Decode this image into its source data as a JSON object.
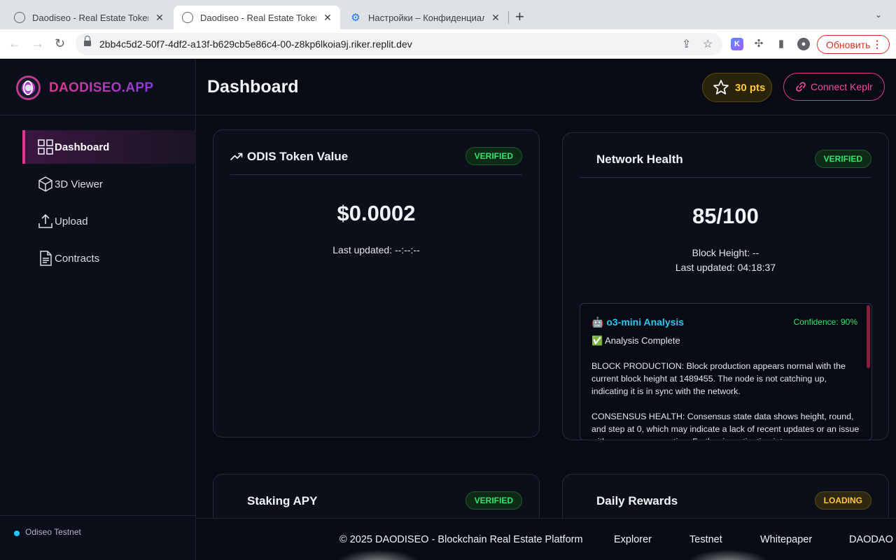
{
  "browser": {
    "tabs": [
      {
        "title": "Daodiseo - Real Estate Tokeniz",
        "active": false
      },
      {
        "title": "Daodiseo - Real Estate Tokeniz",
        "active": true
      },
      {
        "title": "Настройки – Конфиденциальн",
        "active": false
      }
    ],
    "new_tab": "+",
    "url": "2bb4c5d2-50f7-4df2-a13f-b629cb5e86c4-00-z8kp6lkoia9j.riker.replit.dev",
    "update_label": "Обновить"
  },
  "app": {
    "brand": "DAODISEO.APP",
    "page_title": "Dashboard",
    "points": "30 pts",
    "connect_label": "Connect Keplr",
    "network": "Odiseo Testnet",
    "colors": {
      "accent": "#e0388d",
      "verified": "#2ee66b",
      "loading": "#ffc83d",
      "analysis_title": "#29c6f2"
    }
  },
  "sidebar": {
    "items": [
      {
        "label": "Dashboard",
        "icon": "grid-icon",
        "active": true
      },
      {
        "label": "3D Viewer",
        "icon": "cube-icon",
        "active": false
      },
      {
        "label": "Upload",
        "icon": "upload-icon",
        "active": false
      },
      {
        "label": "Contracts",
        "icon": "document-icon",
        "active": false
      }
    ]
  },
  "cards": {
    "token": {
      "title": "ODIS Token Value",
      "badge": "VERIFIED",
      "value": "$0.0002",
      "updated": "Last updated: --:--:--"
    },
    "health": {
      "title": "Network Health",
      "badge": "VERIFIED",
      "value": "85/100",
      "block_height": "Block Height: --",
      "updated": "Last updated: 04:18:37",
      "analysis": {
        "title": "o3-mini Analysis",
        "confidence": "Confidence: 90%",
        "status": "✅ Analysis Complete",
        "paragraphs": [
          "BLOCK PRODUCTION: Block production appears normal with the current block height at 1489455. The node is not catching up, indicating it is in sync with the network.",
          "CONSENSUS HEALTH: Consensus state data shows height, round, and step at 0, which may indicate a lack of recent updates or an issue with consensus reporting. Further investigation into"
        ]
      }
    },
    "staking": {
      "title": "Staking APY",
      "badge": "VERIFIED"
    },
    "rewards": {
      "title": "Daily Rewards",
      "badge": "LOADING"
    }
  },
  "footer": {
    "copyright": "© 2025 DAODISEO - Blockchain Real Estate Platform",
    "links": [
      "Explorer",
      "Testnet",
      "Whitepaper",
      "DAODAO C"
    ]
  }
}
